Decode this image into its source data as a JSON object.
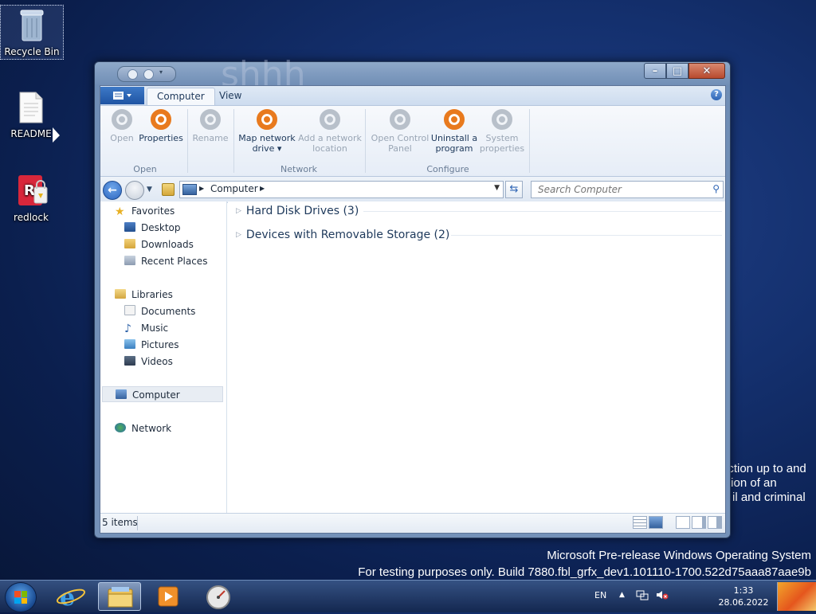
{
  "desktop": {
    "icons": [
      {
        "label": "Recycle Bin",
        "icon": "recycle-bin-icon"
      },
      {
        "label": "README",
        "icon": "text-file-icon"
      },
      {
        "label": "redlock",
        "icon": "redlock-app-icon"
      }
    ],
    "background_text_lines": [
      "action up to and",
      "tion of an",
      "il and criminal"
    ],
    "watermark": {
      "line1": "Microsoft Pre-release Windows Operating System",
      "line2": "For testing purposes only. Build 7880.fbl_grfx_dev1.101110-1700.522d75aaa87aae9b"
    },
    "ghost_title": "shhh"
  },
  "window": {
    "caption_buttons": {
      "minimize": "–",
      "maximize": "□",
      "close": "✕"
    },
    "ribbon": {
      "tabs": [
        {
          "label": "Computer",
          "active": true
        },
        {
          "label": "View",
          "active": false
        }
      ],
      "help": "?",
      "groups": [
        {
          "label": "Open",
          "buttons": [
            {
              "label": "Open",
              "enabled": false
            },
            {
              "label": "Properties",
              "enabled": true
            }
          ]
        },
        {
          "label": "",
          "buttons": [
            {
              "label": "Rename",
              "enabled": false
            }
          ]
        },
        {
          "label": "Network",
          "buttons": [
            {
              "label_line1": "Map network",
              "label_line2": "drive ▾",
              "enabled": true
            },
            {
              "label_line1": "Add a network",
              "label_line2": "location",
              "enabled": false
            }
          ]
        },
        {
          "label": "Configure",
          "buttons": [
            {
              "label_line1": "Open Control",
              "label_line2": "Panel",
              "enabled": false
            },
            {
              "label_line1": "Uninstall a",
              "label_line2": "program",
              "enabled": true
            },
            {
              "label_line1": "System",
              "label_line2": "properties",
              "enabled": false
            }
          ]
        }
      ]
    },
    "address": {
      "path": [
        "Computer"
      ],
      "search_placeholder": "Search Computer"
    },
    "nav_pane": {
      "favorites": {
        "label": "Favorites",
        "items": [
          "Desktop",
          "Downloads",
          "Recent Places"
        ]
      },
      "libraries": {
        "label": "Libraries",
        "items": [
          "Documents",
          "Music",
          "Pictures",
          "Videos"
        ]
      },
      "computer": "Computer",
      "network": "Network"
    },
    "content": {
      "groups": [
        {
          "label": "Hard Disk Drives (3)"
        },
        {
          "label": "Devices with Removable Storage (2)"
        }
      ]
    },
    "status": {
      "item_count": "5 items"
    }
  },
  "taskbar": {
    "language": "EN",
    "time": "1:33",
    "date": "28.06.2022",
    "pinned": [
      "internet-explorer-icon",
      "windows-explorer-icon",
      "media-player-icon",
      "speedometer-app-icon"
    ]
  },
  "colors": {
    "accent": "#2d64b4",
    "ribbon_orange": "#e87a1e"
  }
}
